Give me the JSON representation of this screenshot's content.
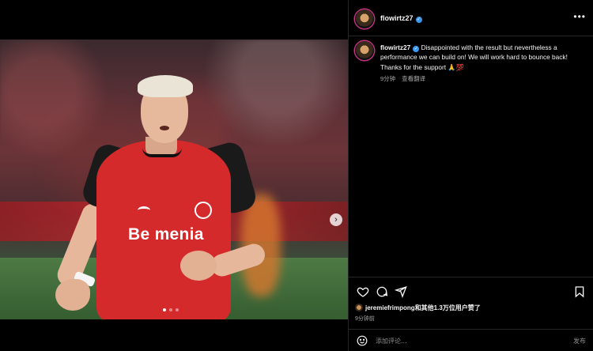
{
  "post": {
    "username": "flowirtz27",
    "verified_icon": "verified-badge-icon",
    "caption_text": "Disappointed with the result but nevertheless a performance we can build on! We will work hard to bounce back! Thanks for the support 🙏💯",
    "caption_time": "9分钟",
    "see_translation": "查看翻译",
    "likes_user": "jeremiefrimpong",
    "likes_text": "和其他1.3万位用户赞了",
    "post_time": "9分钟前"
  },
  "photo": {
    "sponsor_text": "Be menia",
    "carousel_dots": 3,
    "carousel_active_index": 0
  },
  "comment": {
    "placeholder": "添加评论...",
    "post_label": "发布"
  },
  "icons": {
    "more": "more-options-icon",
    "like": "heart-icon",
    "comment": "comment-icon",
    "share": "share-icon",
    "save": "bookmark-icon",
    "emoji": "emoji-icon",
    "next": "chevron-right-icon"
  },
  "colors": {
    "background": "#000000",
    "text": "#f5f5f5",
    "muted": "#a8a8a8",
    "verified": "#3897f0",
    "jersey_red": "#d42a2c"
  }
}
